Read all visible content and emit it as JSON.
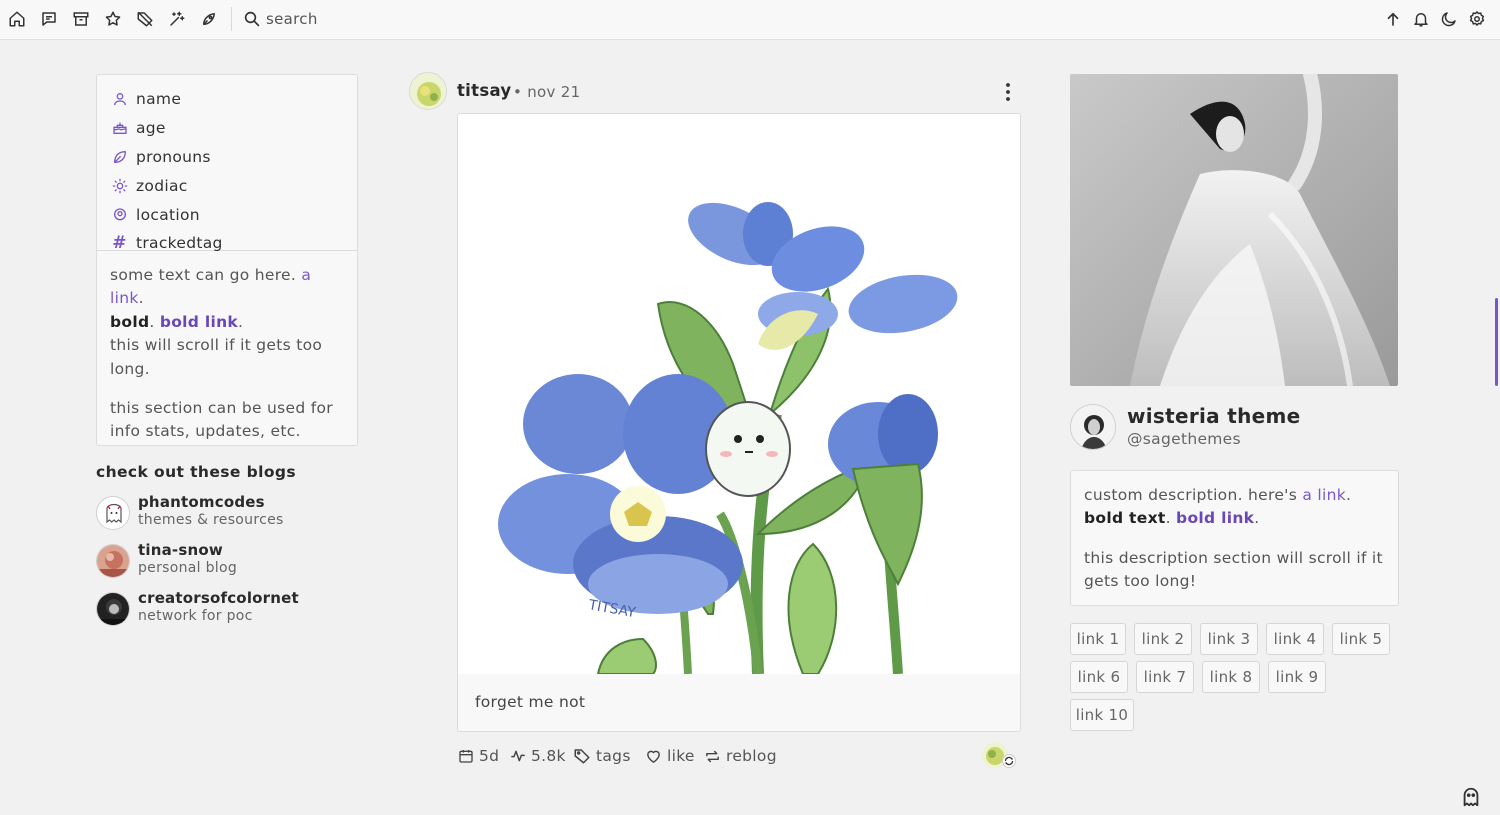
{
  "topbar": {
    "icons": [
      "home-icon",
      "messages-icon",
      "archive-icon",
      "star-icon",
      "tag-off-icon",
      "sparkles-icon",
      "rocket-icon"
    ],
    "search_placeholder": "search",
    "right_icons": [
      "arrow-up-icon",
      "bell-icon",
      "moon-icon",
      "gear-icon"
    ]
  },
  "sidebar": {
    "info": [
      {
        "icon": "user-icon",
        "label": "name"
      },
      {
        "icon": "cake-icon",
        "label": "age"
      },
      {
        "icon": "leaf-icon",
        "label": "pronouns"
      },
      {
        "icon": "sun-icon",
        "label": "zodiac"
      },
      {
        "icon": "pin-icon",
        "label": "location"
      },
      {
        "icon": "hash-icon",
        "label": "trackedtag"
      }
    ],
    "text": {
      "p1_a": "some text can go here. ",
      "p1_link": "a link",
      "p1_b": ".",
      "p1_bold": "bold",
      "p1_c": ". ",
      "p1_boldlink": "bold link",
      "p1_d": ".",
      "p1_e": "this will scroll if it gets too long.",
      "p2": "this section can be used for info stats, updates, etc."
    },
    "blogs_title": "check out these blogs",
    "blogs": [
      {
        "name": "phantomcodes",
        "desc": "themes & resources"
      },
      {
        "name": "tina-snow",
        "desc": "personal blog"
      },
      {
        "name": "creatorsofcolornet",
        "desc": "network for poc"
      }
    ]
  },
  "post": {
    "username": "titsay",
    "date": "• nov 21",
    "caption": "forget me not",
    "signature": "TITSAY",
    "footer": {
      "age": "5d",
      "notes": "5.8k",
      "tags": "tags",
      "like": "like",
      "reblog": "reblog"
    }
  },
  "profile": {
    "title": "wisteria theme",
    "handle": "@sagethemes",
    "desc": {
      "a": "custom description. here's ",
      "link": "a link",
      "b": ". ",
      "bold": "bold text",
      "c": ". ",
      "boldlink": "bold link",
      "d": ".",
      "p2": "this description section will scroll if it gets too long!"
    },
    "links": [
      "link 1",
      "link 2",
      "link 3",
      "link 4",
      "link 5",
      "link 6",
      "link 7",
      "link 8",
      "link 9",
      "link 10"
    ]
  },
  "colors": {
    "accent": "#7a57c9",
    "background": "#f1f1f1",
    "card": "#f8f8f8",
    "border": "#dcdcdc"
  }
}
